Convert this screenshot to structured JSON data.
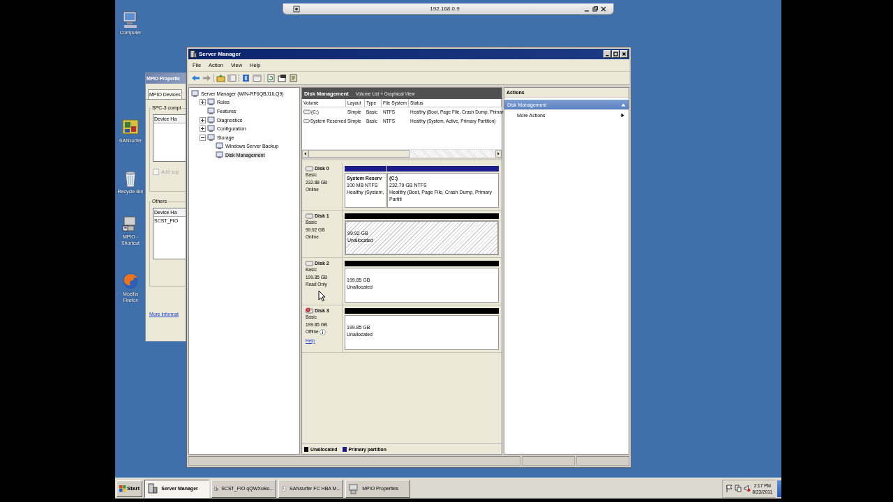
{
  "remote_bar": {
    "title": "192.168.0.9"
  },
  "desktop_icons": [
    {
      "label": "Computer"
    },
    {
      "label": "SANsurfer"
    },
    {
      "label": "Recycle Bin"
    },
    {
      "label": "MPIO - Shortcut"
    },
    {
      "label": "Mozilla Firefox"
    }
  ],
  "mpio_window": {
    "title": "MPIO Propertie",
    "tabs": [
      {
        "label": "MPIO Devices",
        "selected": true
      }
    ],
    "group_1": "SPC-3 compl",
    "list_1_header": "Device Ha",
    "checkbox": {
      "label": "Add sup",
      "checked": false,
      "disabled": true
    },
    "group_2": "Others",
    "list_2_header": "Device Ha",
    "list_2_rows": [
      "SCST_FIO"
    ],
    "link": "More informat"
  },
  "server_manager": {
    "title": "Server Manager",
    "menu": [
      "File",
      "Action",
      "View",
      "Help"
    ],
    "tree": [
      {
        "label": "Server Manager (WIN-RF6QBJ1ILQ9)",
        "selected": false,
        "children": [
          {
            "label": "Roles",
            "selected": false,
            "expanded": false
          },
          {
            "label": "Features",
            "selected": false
          },
          {
            "label": "Diagnostics",
            "selected": false,
            "expanded": false
          },
          {
            "label": "Configuration",
            "selected": false,
            "expanded": false
          },
          {
            "label": "Storage",
            "selected": false,
            "expanded": true,
            "children": [
              {
                "label": "Windows Server Backup",
                "selected": false
              },
              {
                "label": "Disk Management",
                "selected": true
              }
            ]
          }
        ]
      }
    ],
    "disk_management": {
      "title": "Disk Management",
      "subtitle": "Volume List + Graphical View",
      "columns": [
        "Volume",
        "Layout",
        "Type",
        "File System",
        "Status"
      ],
      "rows": [
        [
          "(C:)",
          "Simple",
          "Basic",
          "NTFS",
          "Healthy (Boot, Page File, Crash Dump, Primar"
        ],
        [
          "System Reserved",
          "Simple",
          "Basic",
          "NTFS",
          "Healthy (System, Active, Primary Partition)"
        ]
      ],
      "disks": [
        {
          "name": "Disk 0",
          "kind": "Basic",
          "size": "232.88 GB",
          "status": "Online",
          "offline": false,
          "partitions": [
            {
              "kind": "system",
              "selected": false,
              "label": "System Reserv",
              "size": "100 MB NTFS",
              "state": "Healthy (System,"
            },
            {
              "kind": "primary",
              "selected": false,
              "label": "(C:)",
              "size": "232.79 GB NTFS",
              "state": "Healthy (Boot, Page File, Crash Dump, Primary Partiti"
            }
          ]
        },
        {
          "name": "Disk 1",
          "kind": "Basic",
          "size": "99.92 GB",
          "status": "Online",
          "offline": false,
          "partitions": [
            {
              "kind": "unallocated",
              "selected": true,
              "size": "99.92 GB",
              "state": "Unallocated"
            }
          ]
        },
        {
          "name": "Disk 2",
          "kind": "Basic",
          "size": "199.85 GB",
          "status": "Read Only",
          "offline": false,
          "partitions": [
            {
              "kind": "unallocated",
              "selected": false,
              "size": "199.85 GB",
              "state": "Unallocated"
            }
          ]
        },
        {
          "name": "Disk 3",
          "kind": "Basic",
          "size": "199.85 GB",
          "status": "Offline",
          "offline": true,
          "help": "Help",
          "partitions": [
            {
              "kind": "unallocated",
              "selected": false,
              "size": "199.85 GB",
              "state": "Unallocated"
            }
          ]
        }
      ],
      "legend": [
        {
          "label": "Unallocated",
          "color": "#000000"
        },
        {
          "label": "Primary partition",
          "color": "#1c1c8a"
        }
      ]
    },
    "actions": {
      "title": "Actions",
      "section": "Disk Management",
      "items": [
        "More Actions"
      ]
    }
  },
  "taskbar": {
    "start": "Start",
    "tasks": [
      {
        "label": "Server Manager",
        "selected": true
      },
      {
        "label": "SCST_FIO qQWXuBo...",
        "selected": false
      },
      {
        "label": "SANsurfer FC HBA M...",
        "selected": false
      },
      {
        "label": "MPIO Properties",
        "selected": false
      }
    ],
    "time": "2:17 PM",
    "date": "8/23/2011"
  }
}
